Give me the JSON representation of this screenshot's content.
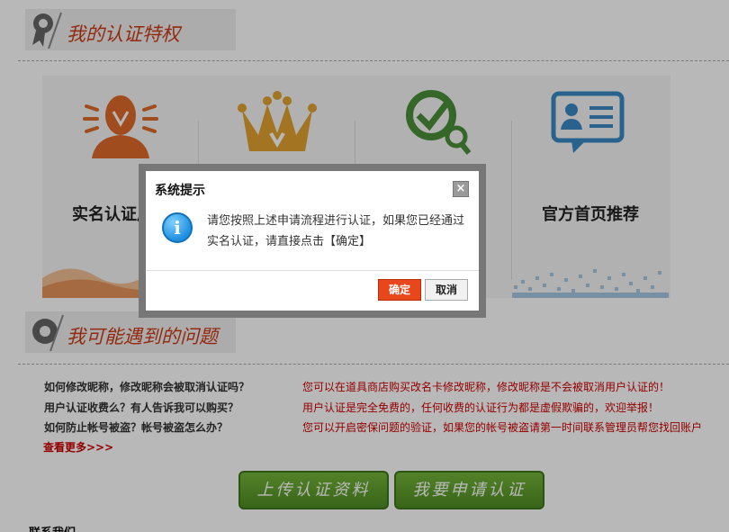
{
  "privileges_section": {
    "title": "我的认证特权"
  },
  "privileges": [
    {
      "label": "实名认证用户",
      "icon": "verified-person-icon"
    },
    {
      "label": "",
      "icon": "crown-icon"
    },
    {
      "label": "",
      "icon": "magnifier-check-icon"
    },
    {
      "label": "官方首页推荐",
      "icon": "id-card-chat-icon"
    }
  ],
  "problems_section": {
    "title": "我可能遇到的问题"
  },
  "faq": [
    {
      "q": "如何修改昵称，修改昵称会被取消认证吗？",
      "a": "您可以在道具商店购买改名卡修改昵称，修改昵称是不会被取消用户认证的！"
    },
    {
      "q": "用户认证收费么？有人告诉我可以购买？",
      "a": "用户认证是完全免费的，任何收费的认证行为都是虚假欺骗的，欢迎举报！"
    },
    {
      "q": "如何防止帐号被盗？帐号被盗怎么办？",
      "a": "您可以开启密保问题的验证，如果您的帐号被盗请第一时间联系管理员帮您找回账户"
    }
  ],
  "more_link": "查看更多>>>",
  "actions": {
    "upload": "上传认证资料",
    "apply": "我要申请认证"
  },
  "contact": "联系我们",
  "dialog": {
    "title": "系统提示",
    "close": "×",
    "icon_glyph": "i",
    "message": "请您按照上述申请流程进行认证，如果您已经通过实名认证，请直接点击【确定】",
    "ok": "确定",
    "cancel": "取消"
  },
  "colors": {
    "accent": "#cc3b16",
    "ok_button": "#e8461b",
    "action_green": "#5a9a2a"
  }
}
